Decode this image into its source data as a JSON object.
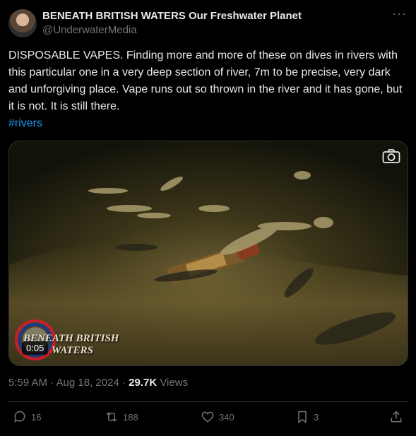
{
  "author": {
    "display_name": "BENEATH BRITISH WATERS Our Freshwater Planet",
    "handle": "@UnderwaterMedia"
  },
  "post": {
    "text": "DISPOSABLE VAPES. Finding more and more of these on dives in rivers with this particular one  in a very deep section of river, 7m to be precise, very dark and unforgiving place. Vape runs out so thrown in the river and it has gone, but it is not. It is still there.",
    "hashtag": "#rivers",
    "timestamp": "5:59 AM · Aug 18, 2024 · ",
    "views_count": "29.7K",
    "views_label": " Views"
  },
  "media": {
    "duration": "0:05",
    "watermark_line1": "BENEATH BRITISH",
    "watermark_line2": "WATERS"
  },
  "actions": {
    "replies": "16",
    "reposts": "188",
    "likes": "340",
    "bookmarks": "3"
  },
  "colors": {
    "background": "#000000",
    "text": "#e7e9ea",
    "muted": "#71767b",
    "link": "#1d9bf0",
    "divider": "#2f3336"
  }
}
